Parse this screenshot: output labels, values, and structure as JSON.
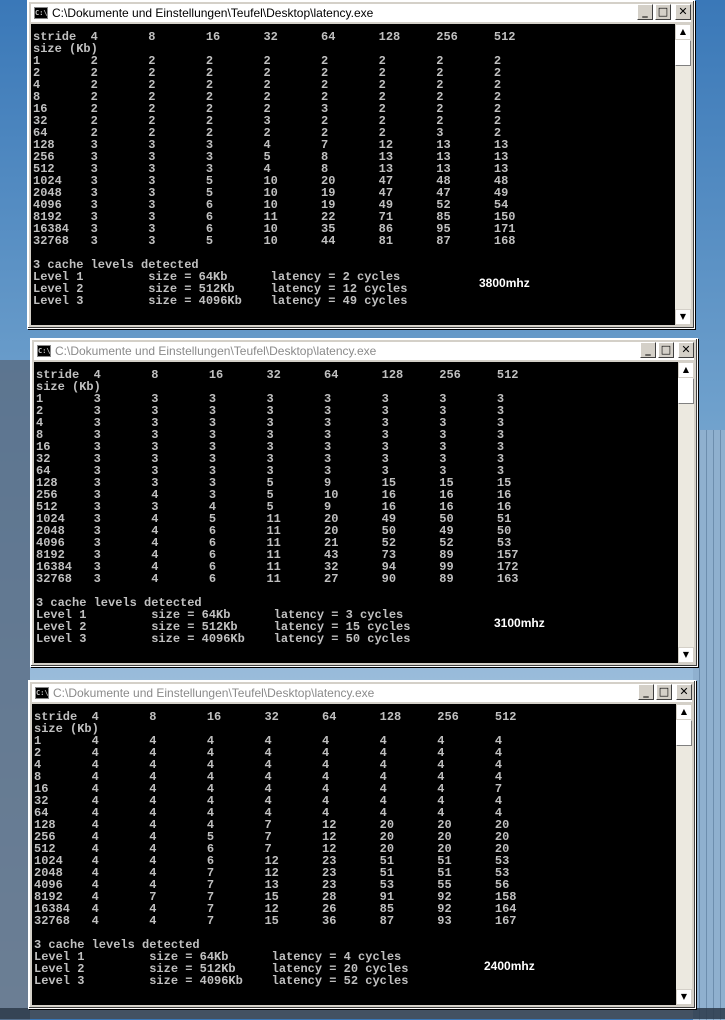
{
  "windows": [
    {
      "title": "C:\\Dokumente und Einstellungen\\Teufel\\Desktop\\latency.exe",
      "active": true,
      "console_text": "stride  4       8       16      32      64      128     256     512\nsize (Kb)\n1       2       2       2       2       2       2       2       2\n2       2       2       2       2       2       2       2       2\n4       2       2       2       2       2       2       2       2\n8       2       2       2       2       2       2       2       2\n16      2       2       2       2       3       2       2       2\n32      2       2       2       3       2       2       2       2\n64      2       2       2       2       2       2       3       2\n128     3       3       3       4       7       12      13      13\n256     3       3       3       5       8       13      13      13\n512     3       3       3       4       8       13      13      13\n1024    3       3       5       10      20      47      48      48\n2048    3       3       5       10      19      47      47      49\n4096    3       3       6       10      19      49      52      54\n8192    3       3       6       11      22      71      85      150\n16384   3       3       6       10      35      86      95      171\n32768   3       3       5       10      44      81      87      168\n\n3 cache levels detected\nLevel 1         size = 64Kb      latency = 2 cycles\nLevel 2         size = 512Kb     latency = 12 cycles\nLevel 3         size = 4096Kb    latency = 49 cycles",
      "mhz_label": "3800mhz"
    },
    {
      "title": "C:\\Dokumente und Einstellungen\\Teufel\\Desktop\\latency.exe",
      "active": false,
      "console_text": "stride  4       8       16      32      64      128     256     512\nsize (Kb)\n1       3       3       3       3       3       3       3       3\n2       3       3       3       3       3       3       3       3\n4       3       3       3       3       3       3       3       3\n8       3       3       3       3       3       3       3       3\n16      3       3       3       3       3       3       3       3\n32      3       3       3       3       3       3       3       3\n64      3       3       3       3       3       3       3       3\n128     3       3       3       5       9       15      15      15\n256     3       4       3       5       10      16      16      16\n512     3       3       4       5       9       16      16      16\n1024    3       4       5       11      20      49      50      51\n2048    3       4       6       11      20      50      49      50\n4096    3       4       6       11      21      52      52      53\n8192    3       4       6       11      43      73      89      157\n16384   3       4       6       11      32      94      99      172\n32768   3       4       6       11      27      90      89      163\n\n3 cache levels detected\nLevel 1         size = 64Kb      latency = 3 cycles\nLevel 2         size = 512Kb     latency = 15 cycles\nLevel 3         size = 4096Kb    latency = 50 cycles",
      "mhz_label": "3100mhz"
    },
    {
      "title": "C:\\Dokumente und Einstellungen\\Teufel\\Desktop\\latency.exe",
      "active": false,
      "console_text": "stride  4       8       16      32      64      128     256     512\nsize (Kb)\n1       4       4       4       4       4       4       4       4\n2       4       4       4       4       4       4       4       4\n4       4       4       4       4       4       4       4       4\n8       4       4       4       4       4       4       4       4\n16      4       4       4       4       4       4       4       7\n32      4       4       4       4       4       4       4       4\n64      4       4       4       4       4       4       4       4\n128     4       4       4       7       12      20      20      20\n256     4       4       5       7       12      20      20      20\n512     4       4       6       7       12      20      20      20\n1024    4       4       6       12      23      51      51      53\n2048    4       4       7       12      23      51      51      53\n4096    4       4       7       13      23      53      55      56\n8192    4       7       7       15      28      91      92      158\n16384   4       4       7       12      26      85      92      164\n32768   4       4       7       15      36      87      93      167\n\n3 cache levels detected\nLevel 1         size = 64Kb      latency = 4 cycles\nLevel 2         size = 512Kb     latency = 20 cycles\nLevel 3         size = 4096Kb    latency = 52 cycles",
      "mhz_label": "2400mhz"
    }
  ],
  "icons": {
    "app": "console-icon",
    "minimize": "minimize-icon",
    "maximize": "maximize-icon",
    "close": "close-icon",
    "scroll_up": "scroll-up-icon",
    "scroll_down": "scroll-down-icon"
  },
  "colors": {
    "console_bg": "#000000",
    "console_text": "#c0c0c0",
    "window_frame": "#d4d0c8"
  }
}
